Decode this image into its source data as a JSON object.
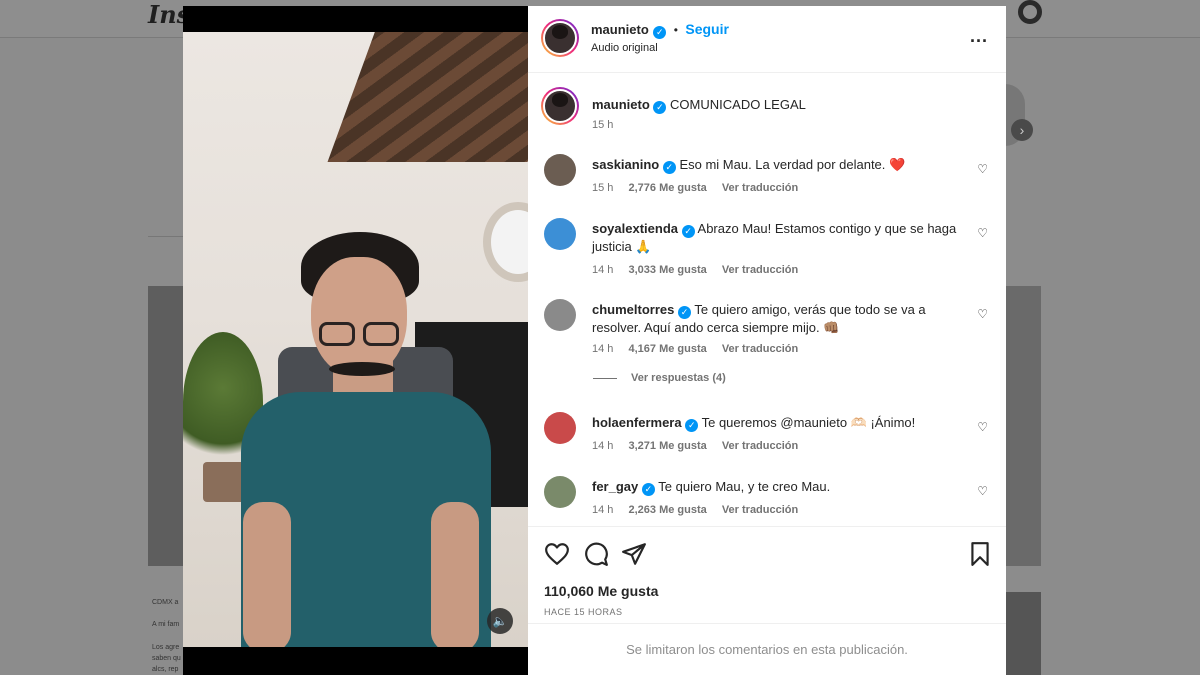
{
  "background": {
    "logo_text": "Inst",
    "side_text": [
      "CDMX a",
      "A mi fam",
      "Los agre",
      "saben qu",
      "alcs, rep"
    ]
  },
  "post": {
    "author": "maunieto",
    "follow_label": "Seguir",
    "follow_separator": "•",
    "audio_label": "Audio original",
    "more_label": "...",
    "caption": "COMUNICADO LEGAL",
    "caption_time": "15 h",
    "likes": "110,060 Me gusta",
    "time_ago": "HACE 15 HORAS",
    "comments_limited": "Se limitaron los comentarios en esta publicación."
  },
  "comments": [
    {
      "user": "saskianino",
      "text": "Eso mi Mau. La verdad por delante. ❤️",
      "time": "15 h",
      "likes": "2,776 Me gusta",
      "translate": "Ver traducción",
      "avatar_color": "#6b5d52"
    },
    {
      "user": "soyalextienda",
      "text": "Abrazo Mau! Estamos contigo y que se haga justicia 🙏",
      "time": "14 h",
      "likes": "3,033 Me gusta",
      "translate": "Ver traducción",
      "avatar_color": "#3c8fd6"
    },
    {
      "user": "chumeltorres",
      "text": "Te quiero amigo, verás que todo se va a resolver. Aquí ando cerca siempre mijo. 👊🏽",
      "time": "14 h",
      "likes": "4,167 Me gusta",
      "translate": "Ver traducción",
      "avatar_color": "#8a8a8a"
    },
    {
      "user": "holaenfermera",
      "text": "Te queremos @maunieto 🫶🏻 ¡Ánimo!",
      "time": "14 h",
      "likes": "3,271 Me gusta",
      "translate": "Ver traducción",
      "avatar_color": "#c94a4a"
    },
    {
      "user": "fer_gay",
      "text": "Te quiero Mau, y te creo Mau.",
      "time": "14 h",
      "likes": "2,263 Me gusta",
      "translate": "Ver traducción",
      "avatar_color": "#7a8a6a"
    }
  ],
  "replies_label": "Ver respuestas (4)",
  "colors": {
    "accent": "#0095f6",
    "text": "#262626",
    "muted": "#737373"
  },
  "icons": [
    "heart-icon",
    "comment-icon",
    "share-icon",
    "bookmark-icon",
    "volume-icon",
    "more-icon",
    "verified-icon"
  ]
}
